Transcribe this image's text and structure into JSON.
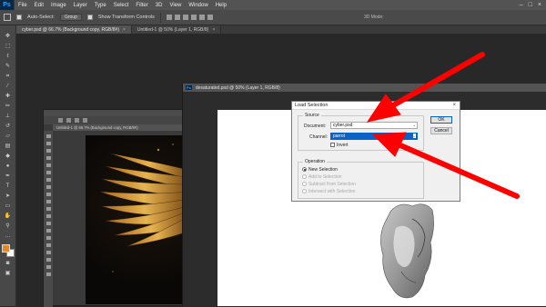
{
  "app": {
    "logo": "Ps"
  },
  "menubar": {
    "items": [
      "File",
      "Edit",
      "Image",
      "Layer",
      "Type",
      "Select",
      "Filter",
      "3D",
      "View",
      "Window",
      "Help"
    ]
  },
  "options_bar": {
    "auto_select_label": "Auto-Select:",
    "auto_select_value": "Group",
    "transform_label": "Show Transform Controls",
    "mode_3d_label": "3D Mode:"
  },
  "tabs": [
    {
      "label": "cyber.psd @ 66.7% (Background copy, RGB/8#)",
      "close": "×"
    },
    {
      "label": "Untitled-1 @ 50% (Layer 1, RGB/8)",
      "close": "×"
    }
  ],
  "doc_secondary": {
    "tab_label": "Untitled-1 @ 66.7% (Background copy, RGB/8#)"
  },
  "doc_main": {
    "tab_label": "desaturated.psd @ 50% (Layer 1, RGB/8)"
  },
  "dialog": {
    "title": "Load Selection",
    "close": "×",
    "source_legend": "Source",
    "document_label": "Document:",
    "document_value": "cyber.psd",
    "channel_label": "Channel:",
    "channel_value": "parrot",
    "invert_label": "Invert",
    "invert_checked": false,
    "operation_legend": "Operation",
    "operations": [
      {
        "label": "New Selection",
        "selected": true,
        "enabled": true
      },
      {
        "label": "Add to Selection",
        "selected": false,
        "enabled": false
      },
      {
        "label": "Subtract from Selection",
        "selected": false,
        "enabled": false
      },
      {
        "label": "Intersect with Selection",
        "selected": false,
        "enabled": false
      }
    ],
    "ok_label": "OK",
    "cancel_label": "Cancel"
  },
  "colors": {
    "accent_arrow": "#ff0000",
    "highlight": "#0a64c8",
    "foreground_swatch": "#e38a1e",
    "background_swatch": "#ffffff",
    "ps_blue": "#2fa3f7"
  },
  "icons": {
    "toolbar": [
      "move-icon",
      "marquee-icon",
      "lasso-icon",
      "quick-select-icon",
      "crop-icon",
      "eyedropper-icon",
      "healing-icon",
      "brush-icon",
      "stamp-icon",
      "history-brush-icon",
      "eraser-icon",
      "gradient-icon",
      "blur-icon",
      "dodge-icon",
      "pen-icon",
      "type-icon",
      "path-select-icon",
      "shape-icon",
      "hand-icon",
      "zoom-icon"
    ]
  }
}
